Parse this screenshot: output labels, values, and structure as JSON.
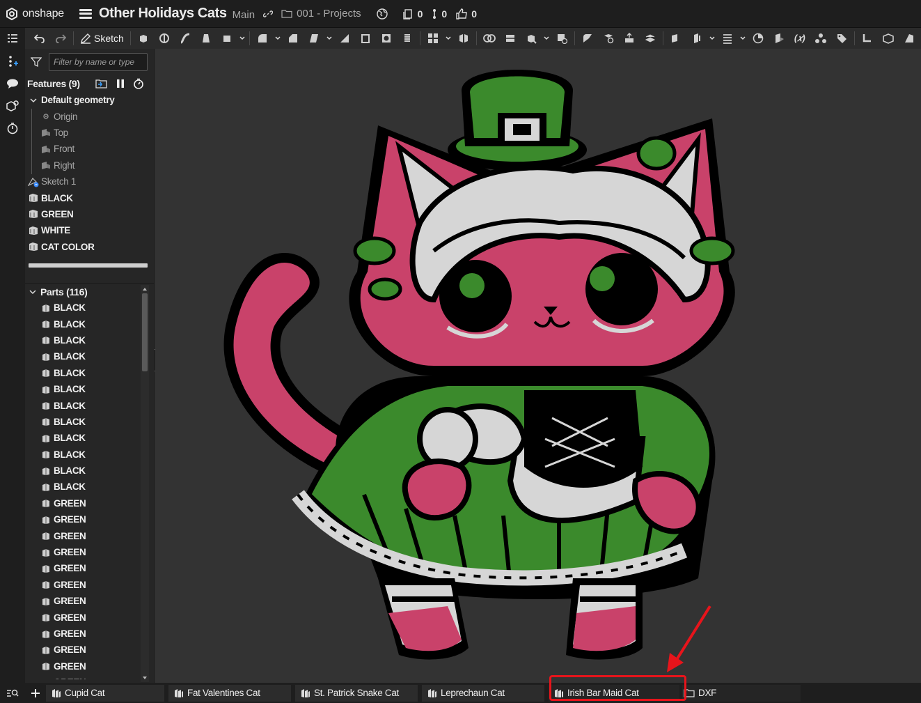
{
  "app": {
    "name": "onshape"
  },
  "document": {
    "title": "Other Holidays Cats",
    "branch": "Main",
    "folder": "001 - Projects"
  },
  "counts": {
    "versions": "0",
    "branches": "0",
    "likes": "0"
  },
  "toolbar": {
    "sketch_label": "Sketch"
  },
  "feature_panel": {
    "filter_placeholder": "Filter by name or type",
    "features_label": "Features (9)",
    "default_geometry_label": "Default geometry",
    "planes": [
      "Origin",
      "Top",
      "Front",
      "Right"
    ],
    "sketch": "Sketch 1",
    "features": [
      "BLACK",
      "GREEN",
      "WHITE",
      "CAT COLOR"
    ]
  },
  "parts_panel": {
    "parts_label": "Parts (116)",
    "parts": [
      "BLACK",
      "BLACK",
      "BLACK",
      "BLACK",
      "BLACK",
      "BLACK",
      "BLACK",
      "BLACK",
      "BLACK",
      "BLACK",
      "BLACK",
      "BLACK",
      "GREEN",
      "GREEN",
      "GREEN",
      "GREEN",
      "GREEN",
      "GREEN",
      "GREEN",
      "GREEN",
      "GREEN",
      "GREEN",
      "GREEN",
      "GREEN"
    ]
  },
  "tabs": [
    {
      "label": "Cupid Cat",
      "type": "part-studio"
    },
    {
      "label": "Fat Valentines Cat",
      "type": "part-studio"
    },
    {
      "label": "St. Patrick Snake Cat",
      "type": "part-studio"
    },
    {
      "label": "Leprechaun Cat",
      "type": "part-studio"
    },
    {
      "label": "Irish Bar Maid Cat",
      "type": "part-studio",
      "active": true
    },
    {
      "label": "DXF",
      "type": "folder"
    }
  ],
  "colors": {
    "cat_pink": "#c9426a",
    "dress_green": "#3b8a2c",
    "white": "#d6d6d6",
    "outline_black": "#000000",
    "highlight_red": "#e8141b",
    "background": "#333333"
  }
}
